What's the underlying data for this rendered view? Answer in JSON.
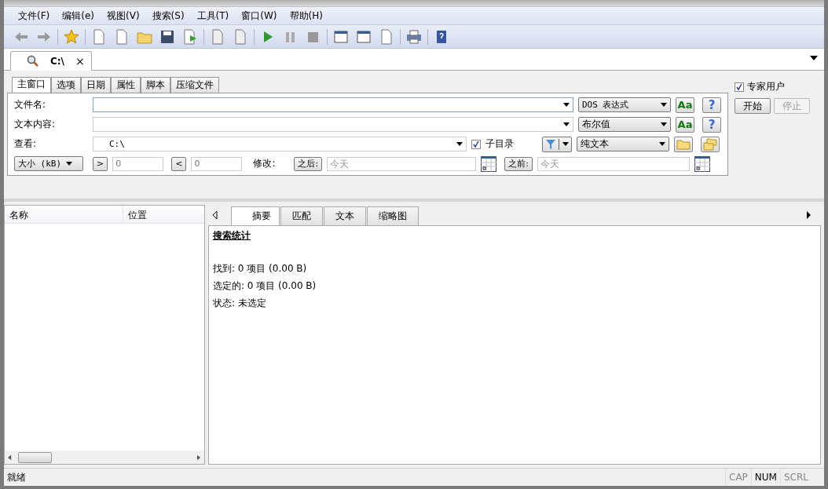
{
  "menu": [
    "文件(F)",
    "编辑(e)",
    "视图(V)",
    "搜索(S)",
    "工具(T)",
    "窗口(W)",
    "帮助(H)"
  ],
  "doc_tab": {
    "label": "C:\\",
    "close": "×"
  },
  "search_tabs": [
    {
      "label": "主窗口",
      "selected": true
    },
    {
      "label": "选项",
      "selected": false
    },
    {
      "label": "日期",
      "selected": false
    },
    {
      "label": "属性",
      "selected": false
    },
    {
      "label": "脚本",
      "selected": false
    },
    {
      "label": "压缩文件",
      "selected": false
    }
  ],
  "filename": {
    "label": "文件名:",
    "mode": "DOS 表达式",
    "case_button": "Aa",
    "help_button": "?"
  },
  "content": {
    "label": "文本内容:",
    "mode": "布尔值",
    "case_button": "Aa",
    "help_button": "?"
  },
  "look_in": {
    "label": "查看:",
    "value": "C:\\",
    "subdirs": {
      "label": "子目录",
      "checked": true
    },
    "mode": "纯文本"
  },
  "size": {
    "unit": "大小 (kB)",
    "gt_button": ">",
    "gt_value": "0",
    "lt_button": "<",
    "lt_value": "0"
  },
  "modified": {
    "label": "修改:",
    "after_button": "之后:",
    "after_placeholder": "今天",
    "before_button": "之前:",
    "before_placeholder": "今天"
  },
  "expert_user": {
    "label": "专家用户",
    "checked": true
  },
  "start_button": {
    "label": "开始",
    "disabled": false
  },
  "stop_button": {
    "label": "停止",
    "disabled": true
  },
  "result_columns": [
    "名称",
    "位置"
  ],
  "result_tabs": [
    {
      "label": "摘要",
      "selected": true
    },
    {
      "label": "匹配",
      "selected": false
    },
    {
      "label": "文本",
      "selected": false
    },
    {
      "label": "缩略图",
      "selected": false
    }
  ],
  "summary": {
    "title": "搜索统计",
    "lines": [
      "找到: 0 项目 (0.00 B)",
      "选定的: 0 项目 (0.00 B)",
      "状态: 未选定"
    ]
  },
  "status_bar": {
    "text": "就绪",
    "indicators": [
      {
        "label": "CAP",
        "on": false
      },
      {
        "label": "NUM",
        "on": true
      },
      {
        "label": "SCRL",
        "on": false
      }
    ]
  }
}
